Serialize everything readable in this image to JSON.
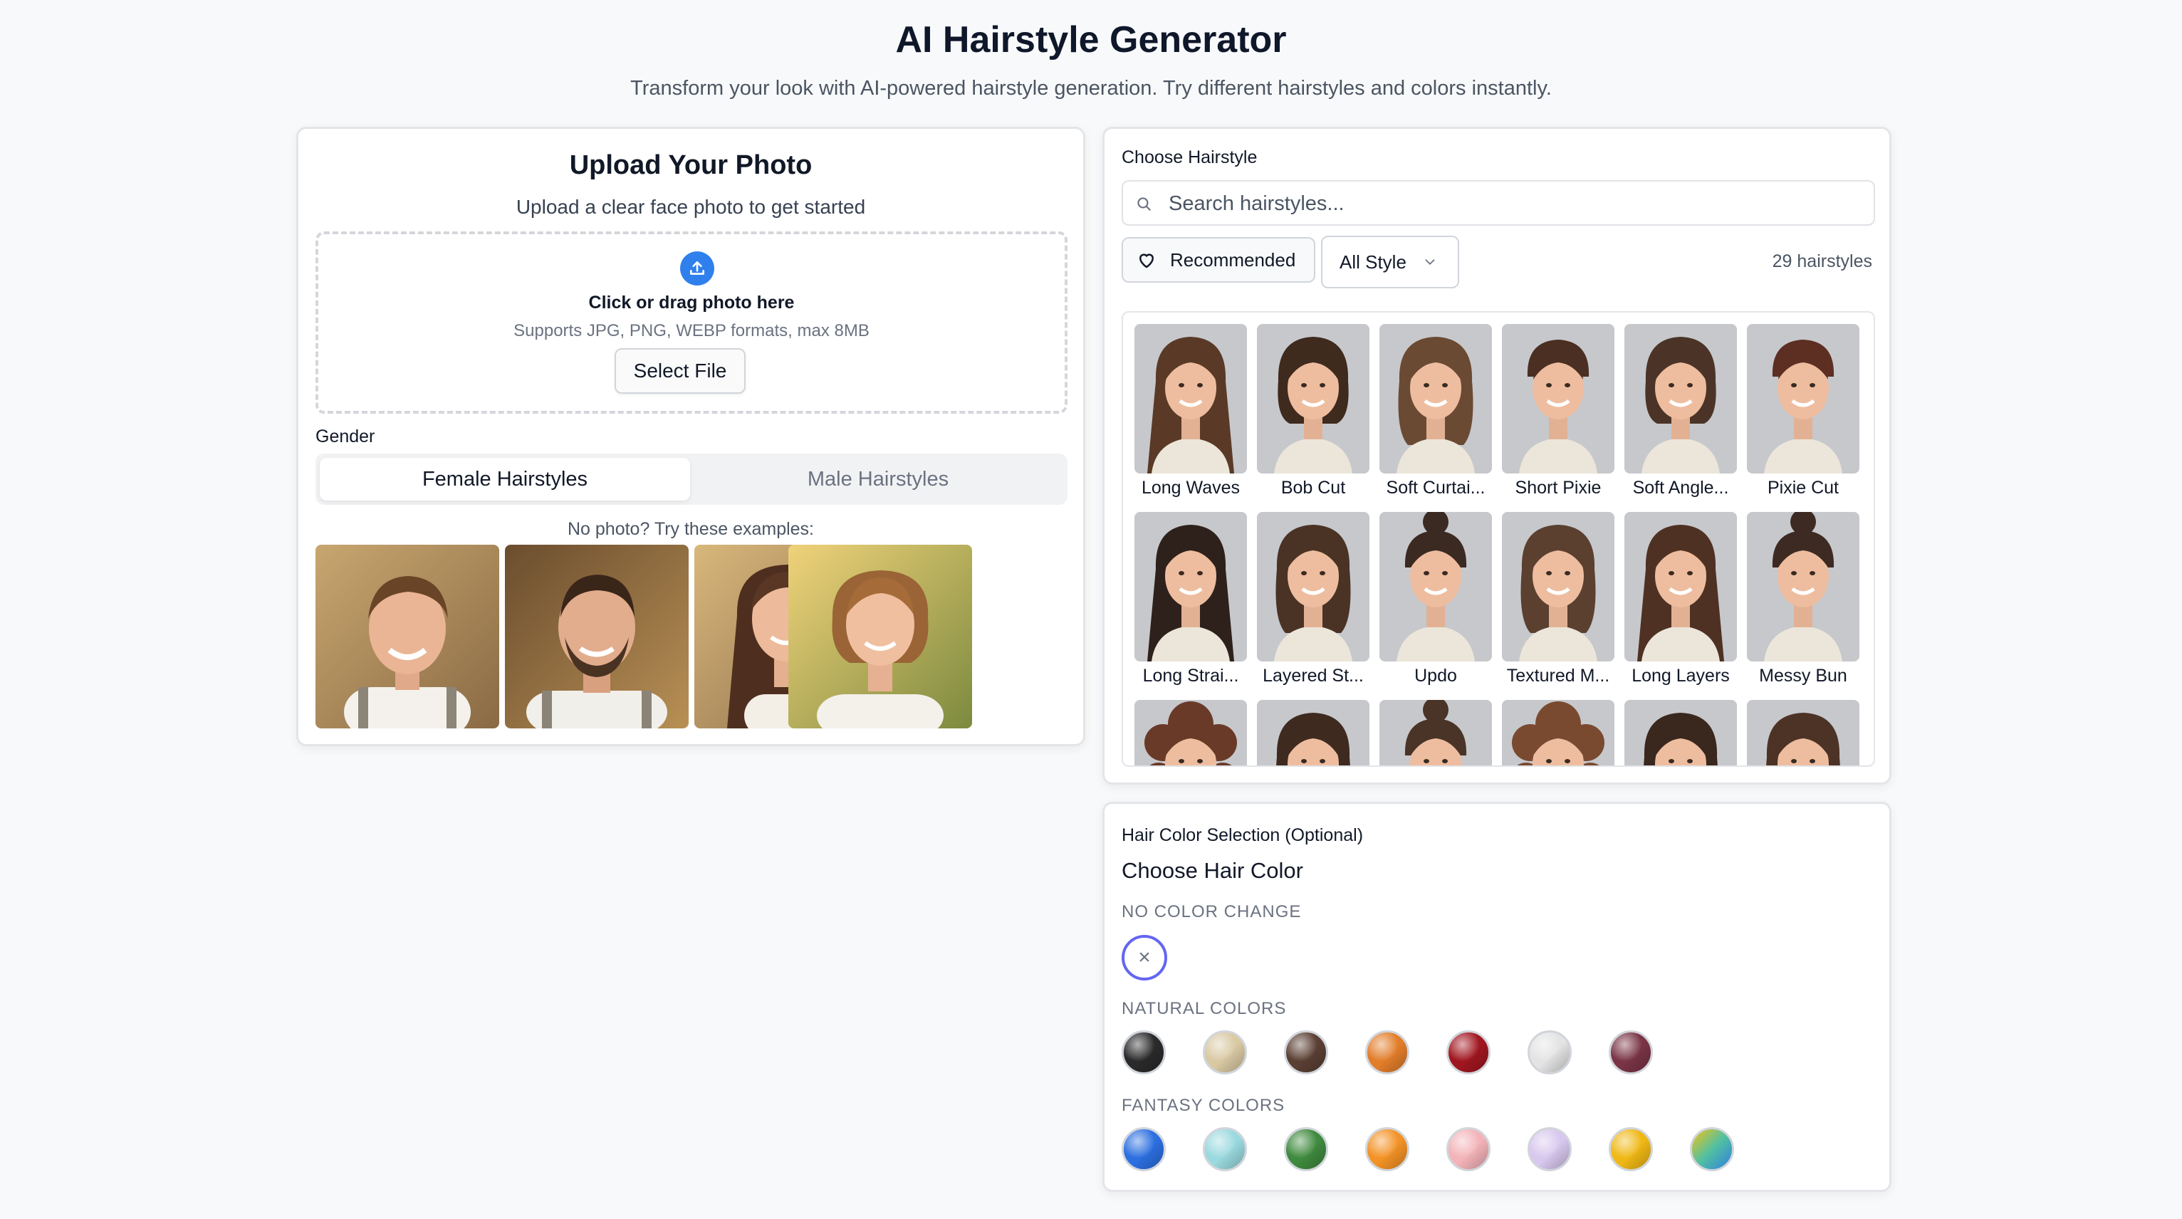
{
  "header": {
    "title": "AI Hairstyle Generator",
    "subtitle": "Transform your look with AI-powered hairstyle generation. Try different hairstyles and colors instantly."
  },
  "upload": {
    "title": "Upload Your Photo",
    "subtitle": "Upload a clear face photo to get started",
    "drop_title": "Click or drag photo here",
    "drop_hint": "Supports JPG, PNG, WEBP formats, max 8MB",
    "select_file_label": "Select File",
    "gender_label": "Gender",
    "gender_tabs": [
      {
        "label": "Female Hairstyles",
        "active": true
      },
      {
        "label": "Male Hairstyles",
        "active": false
      }
    ],
    "examples_label": "No photo? Try these examples:",
    "examples": [
      {
        "icon": "young-man-photo"
      },
      {
        "icon": "bearded-man-photo"
      },
      {
        "icon": "long-hair-woman-photo"
      },
      {
        "icon": "bob-hair-woman-photo"
      }
    ]
  },
  "hairstyles": {
    "section_label": "Choose Hairstyle",
    "search_placeholder": "Search hairstyles...",
    "recommended_label": "Recommended",
    "style_filter_value": "All Style",
    "count_text": "29 hairstyles",
    "items": [
      {
        "label": "Long Waves",
        "hair": "#5a3a26",
        "style": "long"
      },
      {
        "label": "Bob Cut",
        "hair": "#3f2a1e",
        "style": "bob"
      },
      {
        "label": "Soft Curtai...",
        "hair": "#6b4a33",
        "style": "medium"
      },
      {
        "label": "Short Pixie",
        "hair": "#4a2f22",
        "style": "short"
      },
      {
        "label": "Soft Angle...",
        "hair": "#4b3427",
        "style": "bob"
      },
      {
        "label": "Pixie Cut",
        "hair": "#5c2f22",
        "style": "short"
      },
      {
        "label": "Long Strai...",
        "hair": "#2e211b",
        "style": "long"
      },
      {
        "label": "Layered St...",
        "hair": "#4a3325",
        "style": "medium"
      },
      {
        "label": "Updo",
        "hair": "#3b2a22",
        "style": "updo"
      },
      {
        "label": "Textured M...",
        "hair": "#5b4030",
        "style": "medium"
      },
      {
        "label": "Long Layers",
        "hair": "#4f3123",
        "style": "long"
      },
      {
        "label": "Messy Bun",
        "hair": "#3d2a22",
        "style": "updo"
      },
      {
        "label": "",
        "hair": "#6a3a28",
        "style": "curly"
      },
      {
        "label": "",
        "hair": "#3f2a20",
        "style": "medium"
      },
      {
        "label": "",
        "hair": "#4a3428",
        "style": "updo"
      },
      {
        "label": "",
        "hair": "#7a4a30",
        "style": "curly"
      },
      {
        "label": "",
        "hair": "#3a271e",
        "style": "medium"
      },
      {
        "label": "",
        "hair": "#4d3326",
        "style": "medium"
      }
    ]
  },
  "colors": {
    "section_title": "Hair Color Selection (Optional)",
    "choose_label": "Choose Hair Color",
    "no_change_label": "NO COLOR CHANGE",
    "no_change_icon": "close-icon",
    "natural_label": "NATURAL COLORS",
    "natural": [
      "#2a2a2a",
      "#d9c9a3",
      "#5a3f33",
      "#e27d2a",
      "#a0161f",
      "#e3e3e3",
      "#7a3446"
    ],
    "fantasy_label": "FANTASY COLORS",
    "fantasy": [
      "#2c6fe0",
      "#9ad9df",
      "#3f8a3e",
      "#f39226",
      "#f3b3b8",
      "#d8c7ee",
      "#f0b815",
      "rainbow"
    ]
  }
}
